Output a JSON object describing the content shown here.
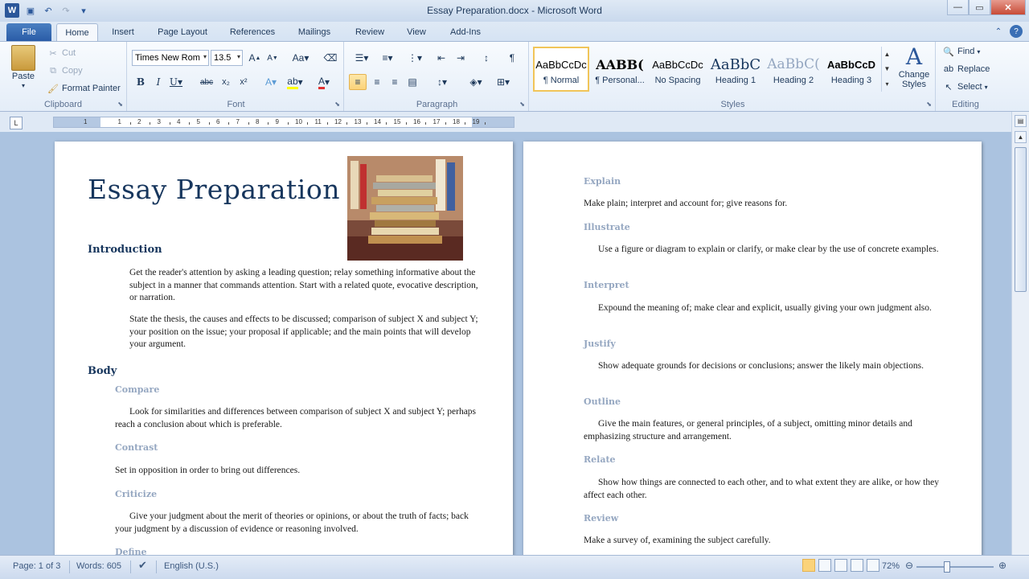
{
  "window": {
    "title": "Essay Preparation.docx - Microsoft Word"
  },
  "tabs": [
    "File",
    "Home",
    "Insert",
    "Page Layout",
    "References",
    "Mailings",
    "Review",
    "View",
    "Add-Ins"
  ],
  "clipboard": {
    "paste": "Paste",
    "cut": "Cut",
    "copy": "Copy",
    "format_painter": "Format Painter",
    "label": "Clipboard"
  },
  "font": {
    "name": "Times New Rom",
    "size": "13.5",
    "label": "Font"
  },
  "paragraph": {
    "label": "Paragraph"
  },
  "styles": {
    "label": "Styles",
    "items": [
      {
        "preview": "AaBbCcDc",
        "name": "¶ Normal"
      },
      {
        "preview": "AABB(",
        "name": "¶ Personal..."
      },
      {
        "preview": "AaBbCcDc",
        "name": "No Spacing"
      },
      {
        "preview": "AaBbC",
        "name": "Heading 1"
      },
      {
        "preview": "AaBbC(",
        "name": "Heading 2"
      },
      {
        "preview": "AaBbCcD",
        "name": "Heading 3"
      }
    ],
    "change_styles": "Change Styles"
  },
  "editing": {
    "find": "Find",
    "replace": "Replace",
    "select": "Select",
    "label": "Editing"
  },
  "ruler": {
    "labels": [
      "1",
      "1",
      "2",
      "3",
      "4",
      "5",
      "6",
      "7",
      "8",
      "9",
      "10",
      "11",
      "12",
      "13",
      "14",
      "15",
      "16",
      "17",
      "18",
      "19"
    ]
  },
  "document": {
    "title": "Essay Preparation",
    "introduction": {
      "heading": "Introduction",
      "p1": "Get the reader's attention by asking a leading question; relay something informative about the subject in a manner that commands attention. Start with a related quote, evocative description, or narration.",
      "p2": "State the thesis, the causes and effects to be discussed; comparison of subject X and subject Y; your position on the issue; your proposal if applicable; and the main points that will develop your argument."
    },
    "body": {
      "heading": "Body",
      "compare_h": "Compare",
      "compare_p": "Look for similarities and differences between comparison of subject X and subject Y; perhaps reach a conclusion about which is preferable.",
      "contrast_h": "Contrast",
      "contrast_p": "Set in opposition in order to bring out differences.",
      "criticize_h": "Criticize",
      "criticize_p": "Give your judgment about the merit of theories or opinions, or about the truth of facts; back your judgment by a discussion of evidence or reasoning involved.",
      "define_h": "Define"
    },
    "page2": {
      "explain_h": "Explain",
      "explain_p": "Make plain; interpret and account for; give reasons for.",
      "illustrate_h": "Illustrate",
      "illustrate_p": "Use a figure or diagram to explain or clarify, or make clear by the use of concrete examples.",
      "interpret_h": "Interpret",
      "interpret_p": "Expound the meaning of; make clear and explicit, usually giving your own judgment also.",
      "justify_h": "Justify",
      "justify_p": "Show adequate grounds for decisions or conclusions; answer the likely main objections.",
      "outline_h": "Outline",
      "outline_p": "Give the main features, or general principles, of a subject, omitting minor details and emphasizing structure and arrangement.",
      "relate_h": "Relate",
      "relate_p": "Show how things are connected to each other, and to what extent they are alike, or how they affect each other.",
      "review_h": "Review",
      "review_p": "Make a survey of, examining the subject carefully."
    }
  },
  "status": {
    "page": "Page: 1 of 3",
    "words": "Words: 605",
    "language": "English (U.S.)",
    "zoom": "72%"
  },
  "colors": {
    "heading": "#17365d",
    "subheading": "#95a7c1",
    "accent": "#2b579a"
  }
}
